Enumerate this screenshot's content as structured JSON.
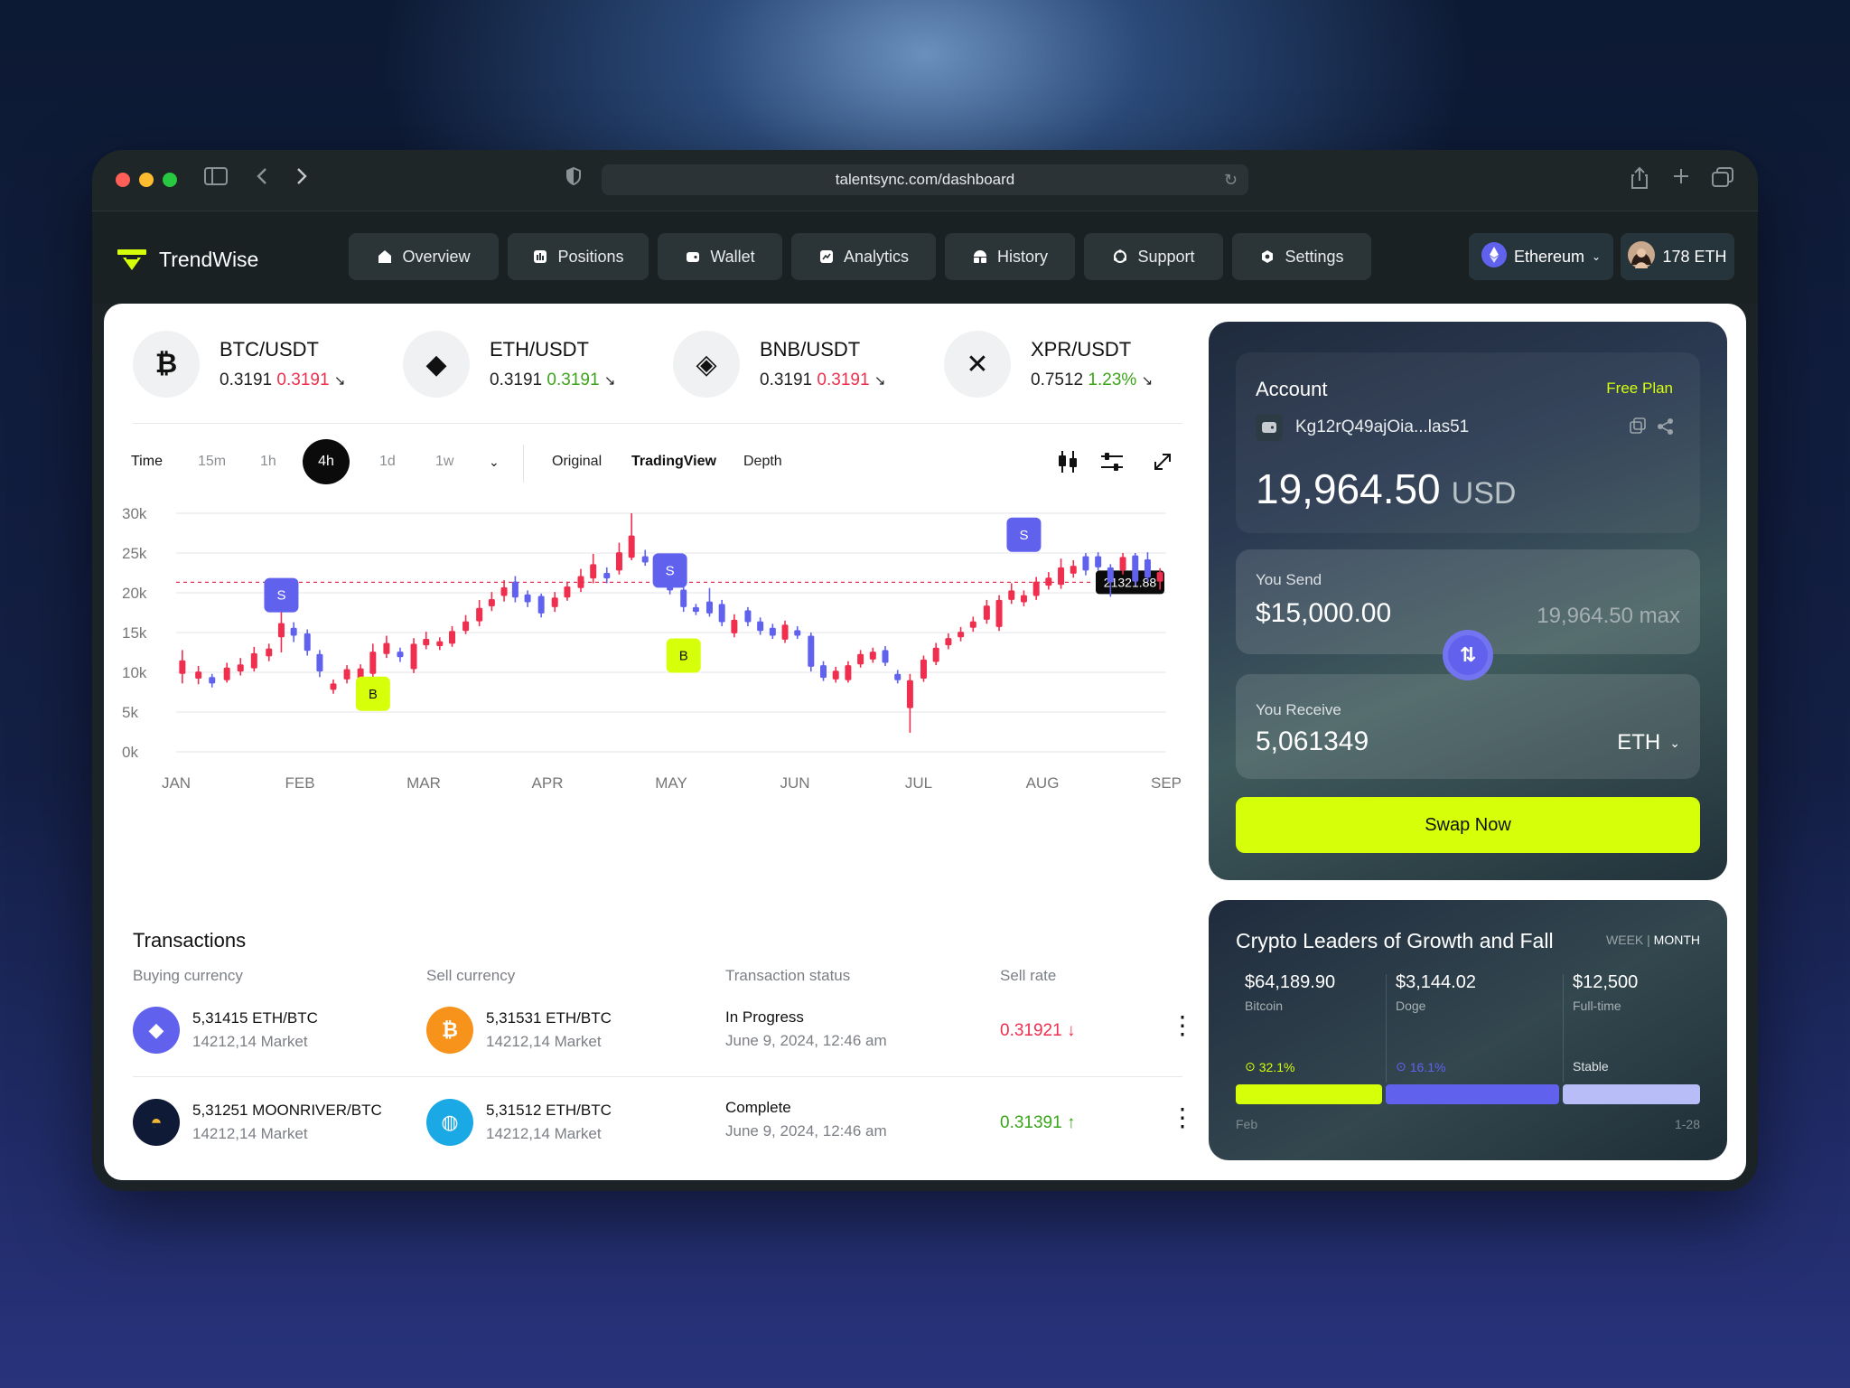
{
  "browser": {
    "url": "talentsync.com/dashboard"
  },
  "app": {
    "name": "TrendWise",
    "nav": [
      {
        "label": "Overview",
        "icon": "home-icon"
      },
      {
        "label": "Positions",
        "icon": "positions-icon"
      },
      {
        "label": "Wallet",
        "icon": "wallet-icon"
      },
      {
        "label": "Analytics",
        "icon": "analytics-icon"
      },
      {
        "label": "History",
        "icon": "history-icon"
      },
      {
        "label": "Support",
        "icon": "support-icon"
      },
      {
        "label": "Settings",
        "icon": "settings-icon"
      }
    ],
    "network": "Ethereum",
    "balance": "178 ETH"
  },
  "tickers": [
    {
      "pair": "BTC/USDT",
      "value": "0.3191",
      "change": "0.3191",
      "direction": "down",
      "icon": "bitcoin-icon",
      "glyph": "₿"
    },
    {
      "pair": "ETH/USDT",
      "value": "0.3191",
      "change": "0.3191",
      "direction": "up",
      "icon": "ethereum-icon",
      "glyph": "◆"
    },
    {
      "pair": "BNB/USDT",
      "value": "0.3191",
      "change": "0.3191",
      "direction": "down",
      "icon": "binance-icon",
      "glyph": "◈"
    },
    {
      "pair": "XPR/USDT",
      "value": "0.7512",
      "change": "1.23%",
      "direction": "up",
      "icon": "xrp-icon",
      "glyph": "✕"
    }
  ],
  "chart_controls": {
    "time_label": "Time",
    "timeframes": [
      "15m",
      "1h",
      "4h",
      "1d",
      "1w"
    ],
    "active_timeframe": "4h",
    "views": [
      "Original",
      "TradingView",
      "Depth"
    ],
    "active_view": "TradingView"
  },
  "chart_data": {
    "type": "candlestick",
    "x_labels": [
      "JAN",
      "FEB",
      "MAR",
      "APR",
      "MAY",
      "JUN",
      "JUL",
      "AUG",
      "SEP"
    ],
    "y_ticks": [
      "0k",
      "5k",
      "10k",
      "15k",
      "20k",
      "25k",
      "30k"
    ],
    "ylim": [
      0,
      30000
    ],
    "current_price_label": "21321.88",
    "current_price": 21321.88,
    "grid": true,
    "up_color": "#f02e4e",
    "down_color": "#6062ee",
    "candles": [
      {
        "t": 0.05,
        "o": 9800,
        "c": 11500,
        "h": 12800,
        "l": 8600
      },
      {
        "t": 0.18,
        "o": 9200,
        "c": 10100,
        "h": 10800,
        "l": 8500
      },
      {
        "t": 0.29,
        "o": 9400,
        "c": 8600,
        "h": 9800,
        "l": 8100
      },
      {
        "t": 0.41,
        "o": 9000,
        "c": 10600,
        "h": 11200,
        "l": 8700
      },
      {
        "t": 0.52,
        "o": 10100,
        "c": 11000,
        "h": 11800,
        "l": 9600
      },
      {
        "t": 0.63,
        "o": 10500,
        "c": 12400,
        "h": 13200,
        "l": 10100
      },
      {
        "t": 0.75,
        "o": 12000,
        "c": 13000,
        "h": 13600,
        "l": 11400
      },
      {
        "t": 0.85,
        "o": 14400,
        "c": 16200,
        "h": 17800,
        "l": 12500
      },
      {
        "t": 0.95,
        "o": 15600,
        "c": 14600,
        "h": 16300,
        "l": 13800
      },
      {
        "t": 1.06,
        "o": 14900,
        "c": 12700,
        "h": 15400,
        "l": 12100
      },
      {
        "t": 1.16,
        "o": 12300,
        "c": 10100,
        "h": 12800,
        "l": 9400
      },
      {
        "t": 1.27,
        "o": 7800,
        "c": 8600,
        "h": 9100,
        "l": 7300
      },
      {
        "t": 1.38,
        "o": 9100,
        "c": 10400,
        "h": 10900,
        "l": 8600
      },
      {
        "t": 1.49,
        "o": 8700,
        "c": 10500,
        "h": 11000,
        "l": 8300
      },
      {
        "t": 1.59,
        "o": 9800,
        "c": 12600,
        "h": 13600,
        "l": 9200
      },
      {
        "t": 1.7,
        "o": 12300,
        "c": 13700,
        "h": 14600,
        "l": 11800
      },
      {
        "t": 1.81,
        "o": 12600,
        "c": 11900,
        "h": 13100,
        "l": 11300
      },
      {
        "t": 1.92,
        "o": 10400,
        "c": 13600,
        "h": 14300,
        "l": 9900
      },
      {
        "t": 2.02,
        "o": 13400,
        "c": 14200,
        "h": 15100,
        "l": 12900
      },
      {
        "t": 2.13,
        "o": 13300,
        "c": 13900,
        "h": 14400,
        "l": 12800
      },
      {
        "t": 2.23,
        "o": 13600,
        "c": 15200,
        "h": 15800,
        "l": 13200
      },
      {
        "t": 2.34,
        "o": 15200,
        "c": 16400,
        "h": 17200,
        "l": 14800
      },
      {
        "t": 2.45,
        "o": 16400,
        "c": 18100,
        "h": 19100,
        "l": 15800
      },
      {
        "t": 2.55,
        "o": 18300,
        "c": 19200,
        "h": 20100,
        "l": 17700
      },
      {
        "t": 2.65,
        "o": 19600,
        "c": 20700,
        "h": 21600,
        "l": 18900
      },
      {
        "t": 2.74,
        "o": 21400,
        "c": 19400,
        "h": 22100,
        "l": 18800
      },
      {
        "t": 2.84,
        "o": 19800,
        "c": 18800,
        "h": 20300,
        "l": 18200
      },
      {
        "t": 2.95,
        "o": 19600,
        "c": 17400,
        "h": 19900,
        "l": 16900
      },
      {
        "t": 3.06,
        "o": 18200,
        "c": 19400,
        "h": 20100,
        "l": 17600
      },
      {
        "t": 3.16,
        "o": 19400,
        "c": 20800,
        "h": 21400,
        "l": 19000
      },
      {
        "t": 3.27,
        "o": 20600,
        "c": 22100,
        "h": 23000,
        "l": 20100
      },
      {
        "t": 3.37,
        "o": 21800,
        "c": 23600,
        "h": 24900,
        "l": 21200
      },
      {
        "t": 3.48,
        "o": 22500,
        "c": 21800,
        "h": 23200,
        "l": 21200
      },
      {
        "t": 3.58,
        "o": 22800,
        "c": 25100,
        "h": 26300,
        "l": 22300
      },
      {
        "t": 3.68,
        "o": 24400,
        "c": 27200,
        "h": 30000,
        "l": 24100
      },
      {
        "t": 3.79,
        "o": 24600,
        "c": 23800,
        "h": 25400,
        "l": 23400
      },
      {
        "t": 3.89,
        "o": 23400,
        "c": 21400,
        "h": 24200,
        "l": 20700
      },
      {
        "t": 3.99,
        "o": 21200,
        "c": 20300,
        "h": 21700,
        "l": 19800
      },
      {
        "t": 4.1,
        "o": 20400,
        "c": 18200,
        "h": 20900,
        "l": 17600
      },
      {
        "t": 4.2,
        "o": 18200,
        "c": 17600,
        "h": 18600,
        "l": 17200
      },
      {
        "t": 4.31,
        "o": 18900,
        "c": 17400,
        "h": 20600,
        "l": 17000
      },
      {
        "t": 4.41,
        "o": 18600,
        "c": 16300,
        "h": 19100,
        "l": 15800
      },
      {
        "t": 4.51,
        "o": 14900,
        "c": 16600,
        "h": 17300,
        "l": 14400
      },
      {
        "t": 4.62,
        "o": 17800,
        "c": 16300,
        "h": 18200,
        "l": 15800
      },
      {
        "t": 4.72,
        "o": 16400,
        "c": 15200,
        "h": 16900,
        "l": 14700
      },
      {
        "t": 4.82,
        "o": 15600,
        "c": 14600,
        "h": 16100,
        "l": 14200
      },
      {
        "t": 4.92,
        "o": 14100,
        "c": 16000,
        "h": 16500,
        "l": 13700
      },
      {
        "t": 5.02,
        "o": 15300,
        "c": 14600,
        "h": 15800,
        "l": 14200
      },
      {
        "t": 5.13,
        "o": 14600,
        "c": 10700,
        "h": 15000,
        "l": 10100
      },
      {
        "t": 5.23,
        "o": 10900,
        "c": 9300,
        "h": 11400,
        "l": 8900
      },
      {
        "t": 5.33,
        "o": 9100,
        "c": 10200,
        "h": 10700,
        "l": 8700
      },
      {
        "t": 5.43,
        "o": 9000,
        "c": 10900,
        "h": 11400,
        "l": 8700
      },
      {
        "t": 5.53,
        "o": 11000,
        "c": 12300,
        "h": 12800,
        "l": 10600
      },
      {
        "t": 5.63,
        "o": 11600,
        "c": 12600,
        "h": 13100,
        "l": 11200
      },
      {
        "t": 5.73,
        "o": 12800,
        "c": 11200,
        "h": 13300,
        "l": 10800
      },
      {
        "t": 5.83,
        "o": 9800,
        "c": 9000,
        "h": 10300,
        "l": 8600
      },
      {
        "t": 5.93,
        "o": 5500,
        "c": 9000,
        "h": 9800,
        "l": 2400
      },
      {
        "t": 6.04,
        "o": 9200,
        "c": 11600,
        "h": 12100,
        "l": 8800
      },
      {
        "t": 6.14,
        "o": 11300,
        "c": 13100,
        "h": 13700,
        "l": 10900
      },
      {
        "t": 6.24,
        "o": 13400,
        "c": 14300,
        "h": 14900,
        "l": 12900
      },
      {
        "t": 6.34,
        "o": 14400,
        "c": 15100,
        "h": 15700,
        "l": 13900
      },
      {
        "t": 6.44,
        "o": 15600,
        "c": 16400,
        "h": 17000,
        "l": 15100
      },
      {
        "t": 6.55,
        "o": 16600,
        "c": 18400,
        "h": 19100,
        "l": 16100
      },
      {
        "t": 6.65,
        "o": 15700,
        "c": 19100,
        "h": 19700,
        "l": 15200
      },
      {
        "t": 6.75,
        "o": 19100,
        "c": 20300,
        "h": 21200,
        "l": 18600
      },
      {
        "t": 6.85,
        "o": 18800,
        "c": 19700,
        "h": 20300,
        "l": 18300
      },
      {
        "t": 6.95,
        "o": 19600,
        "c": 21400,
        "h": 22000,
        "l": 19100
      },
      {
        "t": 7.05,
        "o": 20900,
        "c": 21900,
        "h": 22600,
        "l": 20400
      },
      {
        "t": 7.15,
        "o": 21000,
        "c": 23200,
        "h": 24300,
        "l": 20500
      },
      {
        "t": 7.25,
        "o": 22400,
        "c": 23400,
        "h": 24100,
        "l": 21900
      },
      {
        "t": 7.35,
        "o": 24600,
        "c": 22800,
        "h": 25000,
        "l": 22200
      },
      {
        "t": 7.45,
        "o": 24600,
        "c": 23200,
        "h": 25100,
        "l": 22800
      },
      {
        "t": 7.55,
        "o": 23200,
        "c": 21300,
        "h": 23600,
        "l": 19500
      },
      {
        "t": 7.65,
        "o": 22800,
        "c": 24500,
        "h": 25000,
        "l": 22300
      },
      {
        "t": 7.75,
        "o": 24700,
        "c": 21400,
        "h": 25000,
        "l": 20900
      },
      {
        "t": 7.85,
        "o": 24200,
        "c": 21900,
        "h": 25100,
        "l": 21400
      },
      {
        "t": 7.95,
        "o": 21400,
        "c": 22600,
        "h": 23100,
        "l": 20400
      }
    ],
    "markers": [
      {
        "label": "S",
        "t": 0.85,
        "v": 19700,
        "kind": "sell"
      },
      {
        "label": "B",
        "t": 1.59,
        "v": 7300,
        "kind": "buy"
      },
      {
        "label": "S",
        "t": 3.99,
        "v": 22800,
        "kind": "sell"
      },
      {
        "label": "B",
        "t": 4.1,
        "v": 12100,
        "kind": "buy"
      },
      {
        "label": "S",
        "t": 6.85,
        "v": 27300,
        "kind": "sell"
      }
    ]
  },
  "transactions": {
    "title": "Transactions",
    "headers": [
      "Buying currency",
      "Sell currency",
      "Transaction status",
      "Sell rate"
    ],
    "rows": [
      {
        "buy": {
          "amount": "5,31415 ETH/BTC",
          "market": "14212,14 Market",
          "icon": "ethereum-icon",
          "glyph": "◆",
          "color": "#6062ee"
        },
        "sell": {
          "amount": "5,31531 ETH/BTC",
          "market": "14212,14 Market",
          "icon": "bitcoin-icon",
          "glyph": "₿",
          "color": "#f7931a"
        },
        "status": "In Progress",
        "date": "June 9, 2024, 12:46 am",
        "rate": "0.31921",
        "rate_arrow": "↓",
        "direction": "down"
      },
      {
        "buy": {
          "amount": "5,31251 MOONRIVER/BTC",
          "market": "14212,14 Market",
          "icon": "moonriver-icon",
          "glyph": "◓",
          "color": "#0f1a36"
        },
        "sell": {
          "amount": "5,31512 ETH/BTC",
          "market": "14212,14 Market",
          "icon": "fantom-icon",
          "glyph": "◍",
          "color": "#1ba9e6"
        },
        "status": "Complete",
        "date": "June 9, 2024, 12:46 am",
        "rate": "0.31391",
        "rate_arrow": "↑",
        "direction": "up"
      }
    ]
  },
  "account": {
    "title": "Account",
    "plan": "Free Plan",
    "wallet_address": "Kg12rQ49ajOia...las51",
    "balance": "19,964.50",
    "currency": "USD",
    "send_label": "You Send",
    "send_amount": "$15,000.00",
    "send_max": "19,964.50 max",
    "receive_label": "You Receive",
    "receive_amount": "5,061349",
    "receive_currency": "ETH",
    "swap_button": "Swap Now"
  },
  "leaders": {
    "title": "Crypto Leaders of Growth and Fall",
    "period_week": "WEEK",
    "period_separator": "|",
    "period_month": "MONTH",
    "items": [
      {
        "value": "$64,189.90",
        "name": "Bitcoin",
        "change": "32.1%",
        "color": "#d6ff0a",
        "share": 0.32
      },
      {
        "value": "$3,144.02",
        "name": "Doge",
        "change": "16.1%",
        "color": "#6062ee",
        "share": 0.38
      },
      {
        "value": "$12,500",
        "name": "Full-time",
        "change": "Stable",
        "color": "#b9bdf7",
        "share": 0.3
      }
    ],
    "range_start": "Feb",
    "range_end": "1-28"
  }
}
